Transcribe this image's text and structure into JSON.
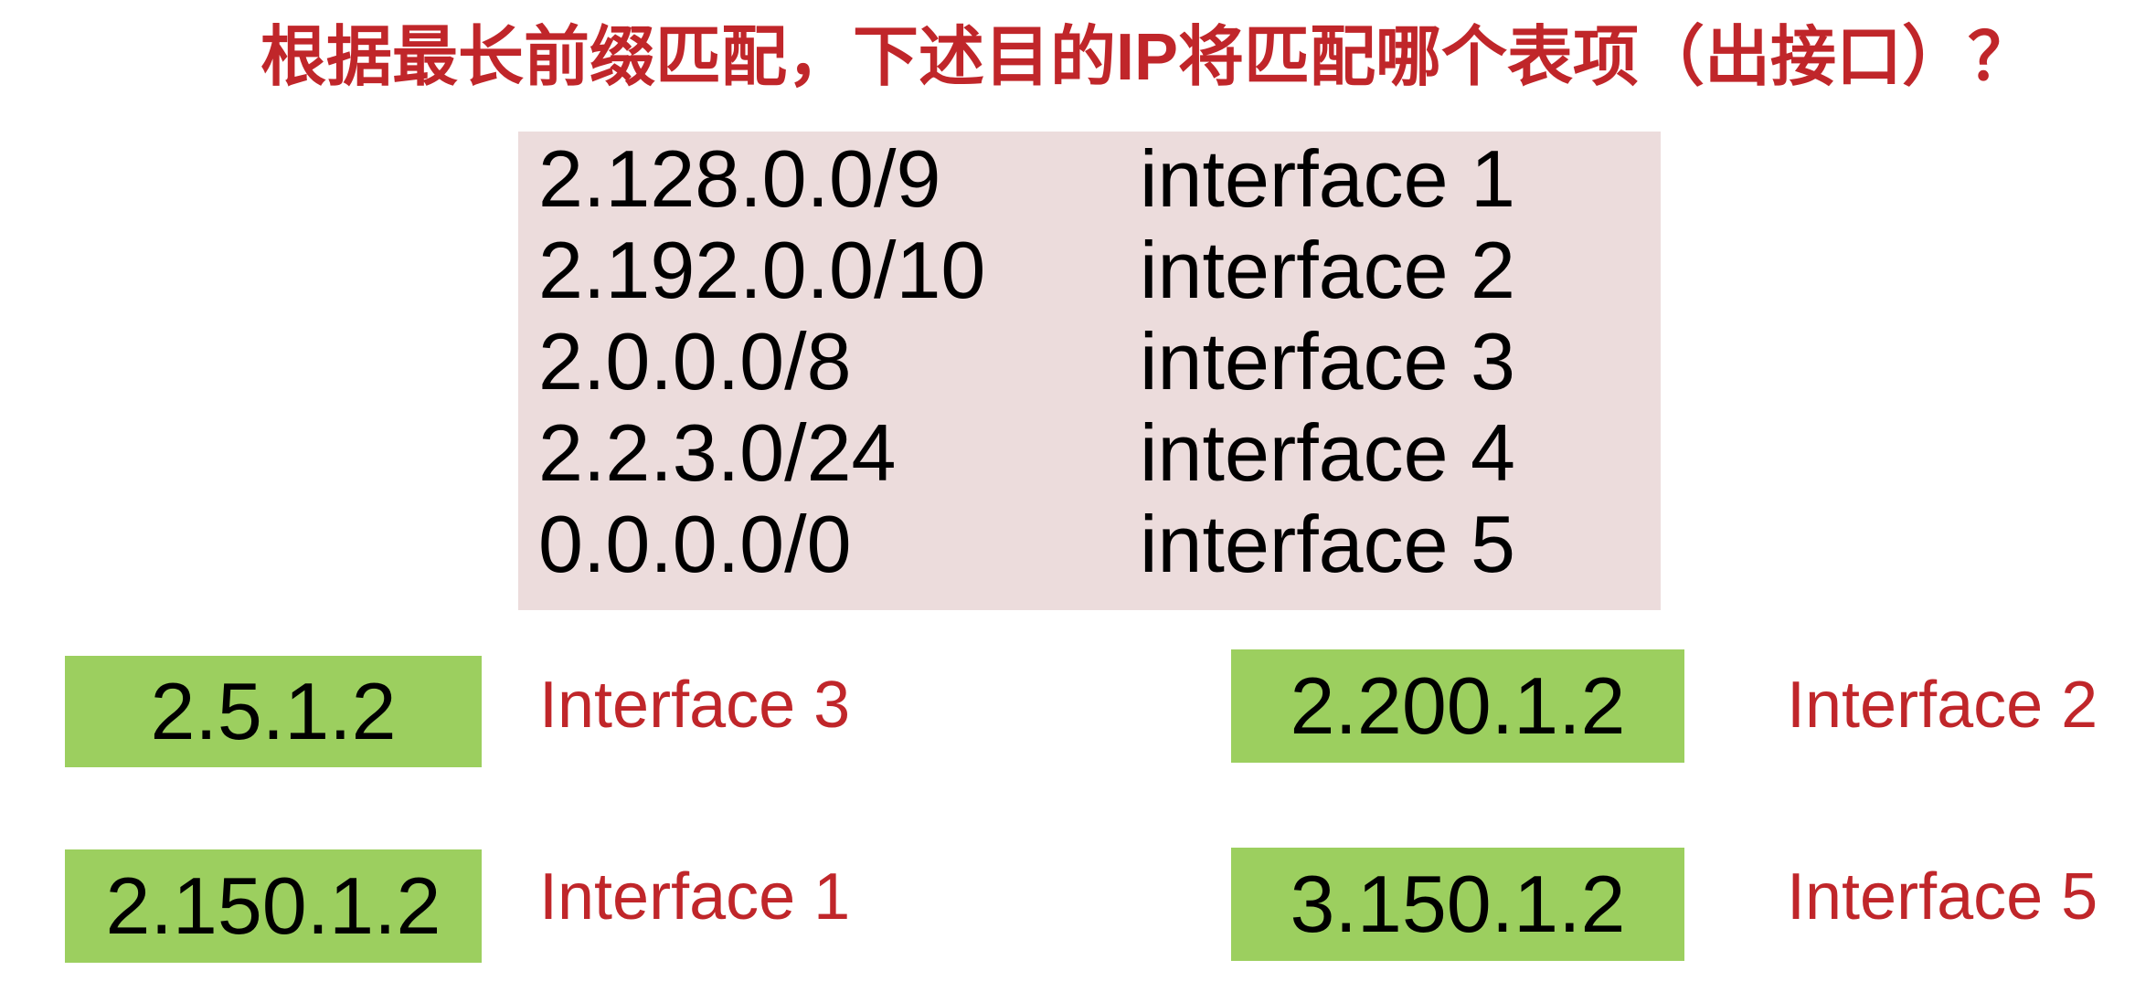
{
  "title": "根据最长前缀匹配，下述目的IP将匹配哪个表项（出接口）？",
  "routing_table": [
    {
      "prefix": "2.128.0.0/9",
      "interface": "interface 1"
    },
    {
      "prefix": "2.192.0.0/10",
      "interface": "interface 2"
    },
    {
      "prefix": "2.0.0.0/8",
      "interface": "interface 3"
    },
    {
      "prefix": "2.2.3.0/24",
      "interface": "interface 4"
    },
    {
      "prefix": "0.0.0.0/0",
      "interface": "interface 5"
    }
  ],
  "queries": [
    {
      "ip": "2.5.1.2",
      "answer": "Interface 3"
    },
    {
      "ip": "2.200.1.2",
      "answer": "Interface 2"
    },
    {
      "ip": "2.150.1.2",
      "answer": "Interface 1"
    },
    {
      "ip": "3.150.1.2",
      "answer": "Interface 5"
    }
  ],
  "colors": {
    "title": "#c0262a",
    "table_background": "#ecdcdc",
    "ip_box": "#9ccf5f",
    "answer": "#c0262a"
  }
}
